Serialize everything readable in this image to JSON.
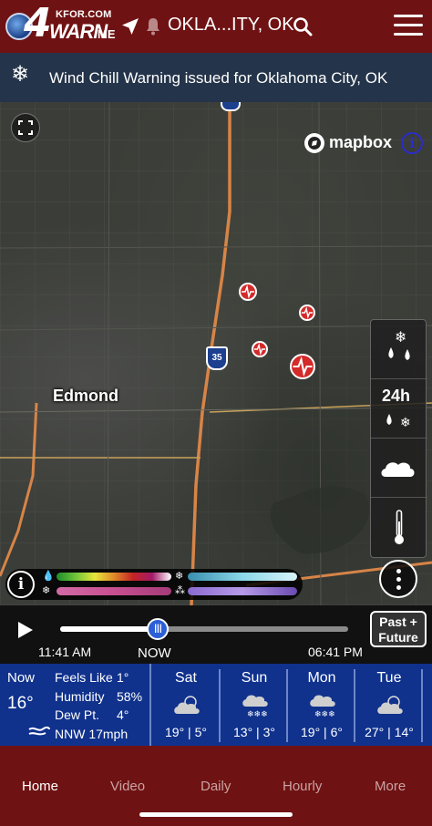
{
  "header": {
    "logo_site": "KFOR.COM",
    "logo_number": "4",
    "logo_warn": "WARN",
    "logo_me": "ME",
    "location": "OKLA...ITY, OK"
  },
  "alert": {
    "text": "Wind Chill Warning issued for Oklahoma City, OK"
  },
  "map": {
    "city_label": "Edmond",
    "interstate_number": "35",
    "attribution": "mapbox",
    "info_glyph": "i",
    "layers": [
      "precip-types",
      "24h-precip",
      "clouds",
      "temperature"
    ],
    "layer_24h_label": "24h",
    "legend_info_glyph": "i"
  },
  "timeline": {
    "start_time": "11:41 AM",
    "now_label": "NOW",
    "end_time": "06:41 PM",
    "position_fraction": 0.34,
    "past_future_label_1": "Past +",
    "past_future_label_2": "Future"
  },
  "current": {
    "now_label": "Now",
    "temp": "16°",
    "labels": [
      "Feels Like",
      "Humidity",
      "Dew Pt.",
      "NNW 17mph"
    ],
    "values": [
      "1°",
      "58%",
      "4°"
    ]
  },
  "forecast": [
    {
      "day": "Sat",
      "temps": "19°  |  5°",
      "icon": "partly-cloudy-icon"
    },
    {
      "day": "Sun",
      "temps": "13°  |  3°",
      "icon": "snow-icon"
    },
    {
      "day": "Mon",
      "temps": "19°  |  6°",
      "icon": "snow-icon"
    },
    {
      "day": "Tue",
      "temps": "27°  |  14°",
      "icon": "partly-cloudy-icon"
    }
  ],
  "nav": {
    "items": [
      "Home",
      "Video",
      "Daily",
      "Hourly",
      "More"
    ],
    "active": "Home"
  },
  "colors": {
    "header_bg": "#6f1213",
    "alert_bg": "#24344a",
    "forecast_bg": "#10328d",
    "road": "#d78447",
    "pin": "#d42a2a"
  }
}
